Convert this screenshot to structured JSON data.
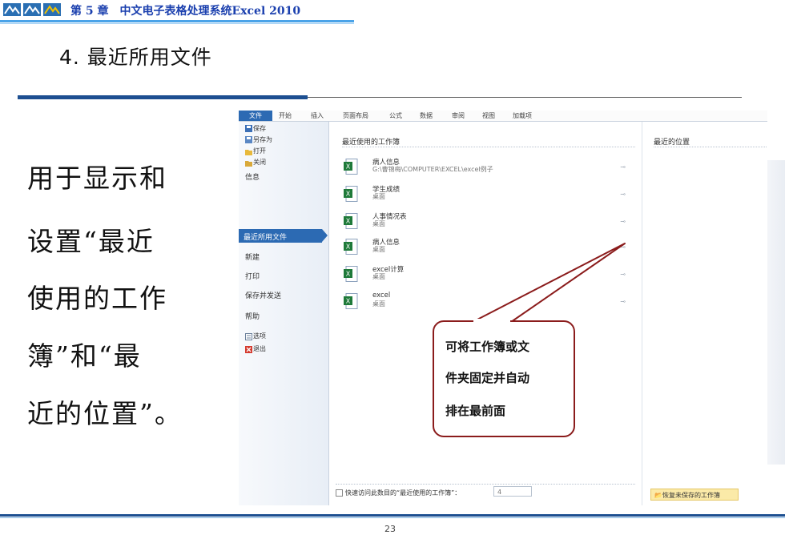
{
  "header": {
    "title": "第 5 章　中文电子表格处理系统Excel 2010"
  },
  "slide": {
    "title": "4. 最近所用文件",
    "description_lines": [
      "用于显示和",
      "设置“最近",
      "使用的工作",
      "簿”和“最",
      "近的位置”。"
    ],
    "page_number": "23"
  },
  "excel": {
    "ribbon_tabs": [
      "文件",
      "开始",
      "插入",
      "页面布局",
      "公式",
      "数据",
      "审阅",
      "视图",
      "加载项"
    ],
    "left_nav": {
      "save": "保存",
      "save_as": "另存为",
      "open": "打开",
      "close": "关闭",
      "info": "信息",
      "recent": "最近所用文件",
      "new": "新建",
      "print": "打印",
      "save_send": "保存并发送",
      "help": "帮助",
      "options": "选项",
      "exit": "退出"
    },
    "recent_workbooks_title": "最近使用的工作簿",
    "recent_places_title": "最近的位置",
    "files": [
      {
        "name": "病人信息",
        "path": "G:\\曹锦梅\\COMPUTER\\EXCEL\\excel例子"
      },
      {
        "name": "学生成绩",
        "path": "桌面"
      },
      {
        "name": "人事情况表",
        "path": "桌面"
      },
      {
        "name": "病人信息",
        "path": "桌面"
      },
      {
        "name": "excel计算",
        "path": "桌面"
      },
      {
        "name": "excel",
        "path": "桌面"
      }
    ],
    "quick_access_label": "快速访问此数目的“最近使用的工作簿”：",
    "quick_access_count": "4",
    "restore_button": "恢复未保存的工作簿"
  },
  "callout": {
    "lines": [
      "可将工作簿或文",
      "件夹固定并自动",
      "排在最前面"
    ]
  },
  "colors": {
    "accent_blue": "#2c6ab3",
    "callout_border": "#8b1c1c",
    "header_text": "#1a3fae"
  }
}
